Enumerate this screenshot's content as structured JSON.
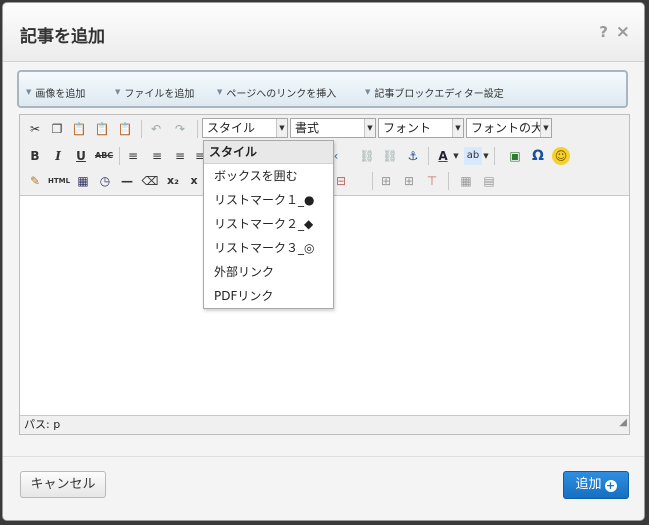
{
  "dialog": {
    "title": "記事を追加",
    "help": "?",
    "close": "×"
  },
  "quickbar": {
    "items": [
      "画像を追加",
      "ファイルを追加",
      "ページへのリンクを挿入",
      "記事ブロックエディター設定"
    ]
  },
  "toolbar": {
    "style_combo": "スタイル",
    "format_combo": "書式",
    "font_combo": "フォント",
    "fontsize_combo": "フォントの大き",
    "bold": "B",
    "italic": "I",
    "underline": "U",
    "strike": "ABC",
    "html": "HTML",
    "subscript": "x₂",
    "superscript": "x"
  },
  "style_menu": {
    "header": "スタイル",
    "items": [
      "ボックスを囲む",
      "リストマーク１_●",
      "リストマーク２_◆",
      "リストマーク３_◎",
      "外部リンク",
      "PDFリンク"
    ]
  },
  "pathbar": {
    "label": "パス: p"
  },
  "footer": {
    "cancel": "キャンセル",
    "add": "追加"
  },
  "icons": [
    "cut-icon",
    "copy-icon",
    "paste-icon",
    "paste-text-icon",
    "paste-word-icon",
    "undo-icon",
    "redo-icon",
    "align-left-icon",
    "align-center-icon",
    "align-right-icon",
    "link-icon",
    "unlink-icon",
    "anchor-icon",
    "text-color-icon",
    "bg-color-icon",
    "image-icon",
    "special-char-icon",
    "smiley-icon",
    "clear-format-icon",
    "template-icon",
    "clock-icon",
    "horizontal-rule-icon",
    "eraser-icon",
    "table-icon"
  ],
  "colors": {
    "accent": "#1a72c4",
    "quickbar_border": "#a7b6bf"
  }
}
